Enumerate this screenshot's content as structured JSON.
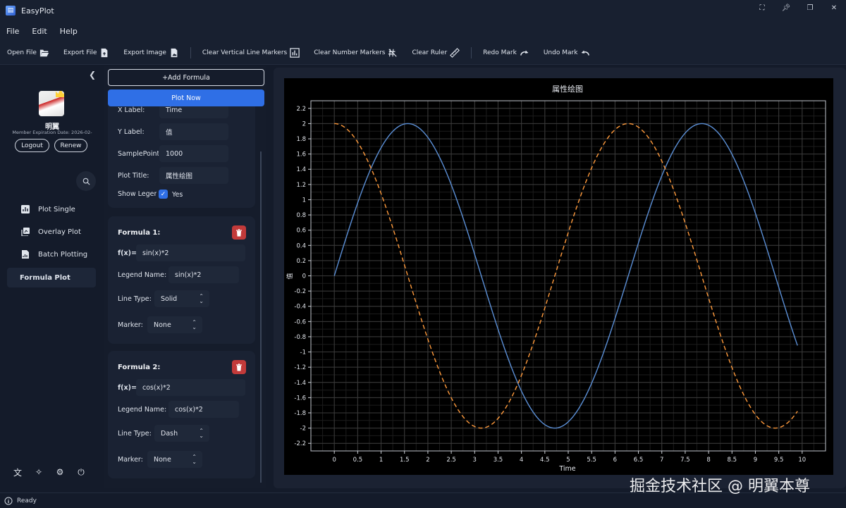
{
  "app": {
    "title": "EasyPlot"
  },
  "menu": [
    "File",
    "Edit",
    "Help"
  ],
  "toolbar": {
    "open_file": "Open File",
    "export_file": "Export File",
    "export_image": "Export Image",
    "clear_vlines": "Clear Vertical Line Markers",
    "clear_numbers": "Clear Number Markers",
    "clear_ruler": "Clear Ruler",
    "redo": "Redo Mark",
    "undo": "Undo Mark"
  },
  "user": {
    "name": "明翼",
    "expiration": "Member Expiration Date: 2026-02-",
    "logout": "Logout",
    "renew": "Renew"
  },
  "nav": {
    "items": [
      {
        "label": "Plot Single",
        "icon": "bar-chart-icon"
      },
      {
        "label": "Overlay Plot",
        "icon": "layers-icon"
      },
      {
        "label": "Batch Plotting",
        "icon": "file-chart-icon"
      },
      {
        "label": "Formula Plot",
        "icon": ""
      }
    ],
    "active": "Formula Plot"
  },
  "panel": {
    "add_formula": "+Add Formula",
    "plot_now": "Plot Now",
    "settings": {
      "xlabel_label": "X Label:",
      "xlabel_value": "Time",
      "ylabel_label": "Y Label:",
      "ylabel_value": "值",
      "samples_label": "SamplePoint",
      "samples_value": "1000",
      "title_label": "Plot Title:",
      "title_value": "属性绘图",
      "legend_label": "Show Legend",
      "legend_value": "Yes"
    },
    "formulas": [
      {
        "title": "Formula 1:",
        "fx_label": "f(x)=",
        "fx": "sin(x)*2",
        "legend_label": "Legend Name:",
        "legend": "sin(x)*2",
        "linetype_label": "Line Type:",
        "linetype": "Solid",
        "marker_label": "Marker:",
        "marker": "None"
      },
      {
        "title": "Formula 2:",
        "fx_label": "f(x)=",
        "fx": "cos(x)*2",
        "legend_label": "Legend Name:",
        "legend": "cos(x)*2",
        "linetype_label": "Line Type:",
        "linetype": "Dash",
        "marker_label": "Marker:",
        "marker": "None"
      }
    ]
  },
  "status": "Ready",
  "watermark": "掘金技术社区 @ 明翼本尊",
  "colors": {
    "accent": "#2f6fe6",
    "series1": "#5b8fd6",
    "series2": "#ff9a3c",
    "danger": "#c23a3a"
  },
  "chart_data": {
    "type": "line",
    "title": "属性绘图",
    "xlabel": "Time",
    "ylabel": "值",
    "xlim": [
      -0.5,
      10.5
    ],
    "ylim": [
      -2.3,
      2.3
    ],
    "xticks": [
      "0",
      "0.5",
      "1",
      "1.5",
      "2",
      "2.5",
      "3",
      "3.5",
      "4",
      "4.5",
      "5",
      "5.5",
      "6",
      "6.5",
      "7",
      "7.5",
      "8",
      "8.5",
      "9",
      "9.5",
      "10"
    ],
    "yticks": [
      "2.2",
      "2",
      "1.8",
      "1.6",
      "1.4",
      "1.2",
      "1",
      "0.8",
      "0.6",
      "0.4",
      "0.2",
      "0",
      "-0.2",
      "-0.4",
      "-0.6",
      "-0.8",
      "-1",
      "-1.2",
      "-1.4",
      "-1.6",
      "-1.8",
      "-2",
      "-2.2"
    ],
    "grid": true,
    "series": [
      {
        "formula": "sin(x)*2",
        "style": "solid",
        "color": "#5b8fd6",
        "x": [
          0,
          1.5708,
          3.1416,
          4.7124,
          6.2832,
          7.854,
          9.4248,
          9.9
        ],
        "y": [
          0,
          2,
          0,
          -2,
          0,
          2,
          0,
          -0.914
        ]
      },
      {
        "formula": "cos(x)*2",
        "style": "dash",
        "color": "#ff9a3c",
        "x": [
          0,
          1.5708,
          3.1416,
          4.7124,
          6.2832,
          7.854,
          9.4248,
          9.9
        ],
        "y": [
          2,
          0,
          -2,
          0,
          2,
          0,
          -2,
          -1.78
        ]
      }
    ]
  }
}
